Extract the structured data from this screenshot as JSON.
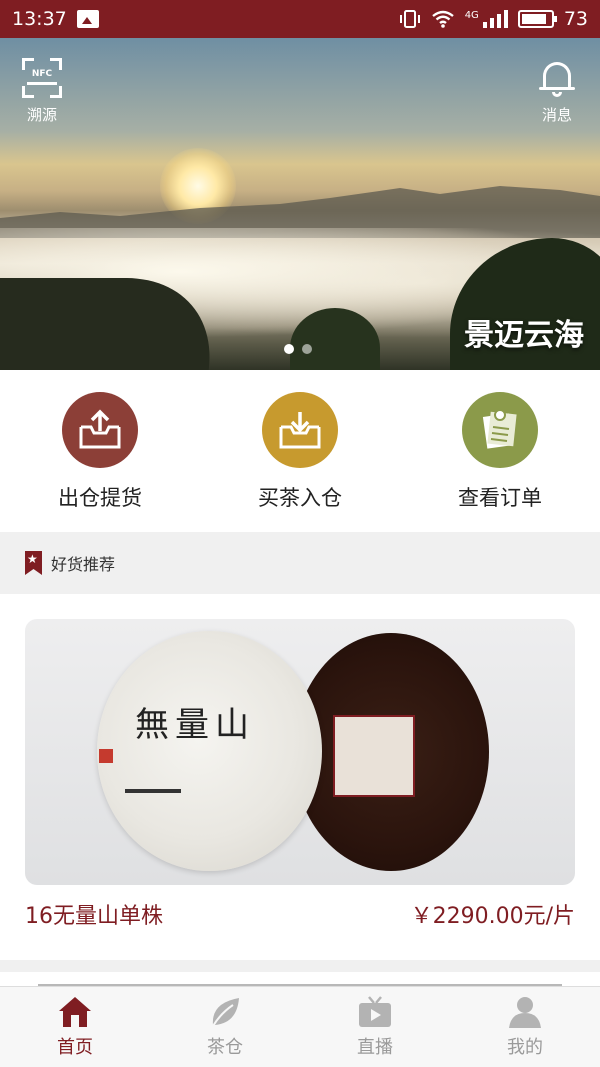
{
  "status_bar": {
    "time": "13:37",
    "network": "4G",
    "battery": "73"
  },
  "banner": {
    "trace_label": "溯源",
    "nfc_text": "NFC",
    "message_label": "消息",
    "caption": "景迈云海",
    "slide_count": 2,
    "active_slide": 1
  },
  "actions": [
    {
      "label": "出仓提货",
      "color": "#8c3f37",
      "icon": "box-out-icon"
    },
    {
      "label": "买茶入仓",
      "color": "#c79a2e",
      "icon": "box-in-icon"
    },
    {
      "label": "查看订单",
      "color": "#8b9a4a",
      "icon": "order-list-icon"
    }
  ],
  "section": {
    "title": "好货推荐"
  },
  "products": [
    {
      "name": "16无量山单株",
      "price": "￥2290.00元/片",
      "cake_text": "無量山"
    }
  ],
  "bottom_nav": [
    {
      "label": "首页",
      "icon": "home-icon",
      "active": true
    },
    {
      "label": "茶仓",
      "icon": "leaf-icon",
      "active": false
    },
    {
      "label": "直播",
      "icon": "tv-play-icon",
      "active": false
    },
    {
      "label": "我的",
      "icon": "user-icon",
      "active": false
    }
  ],
  "colors": {
    "brand": "#7f1d22",
    "inactive": "#9a9a9a"
  }
}
